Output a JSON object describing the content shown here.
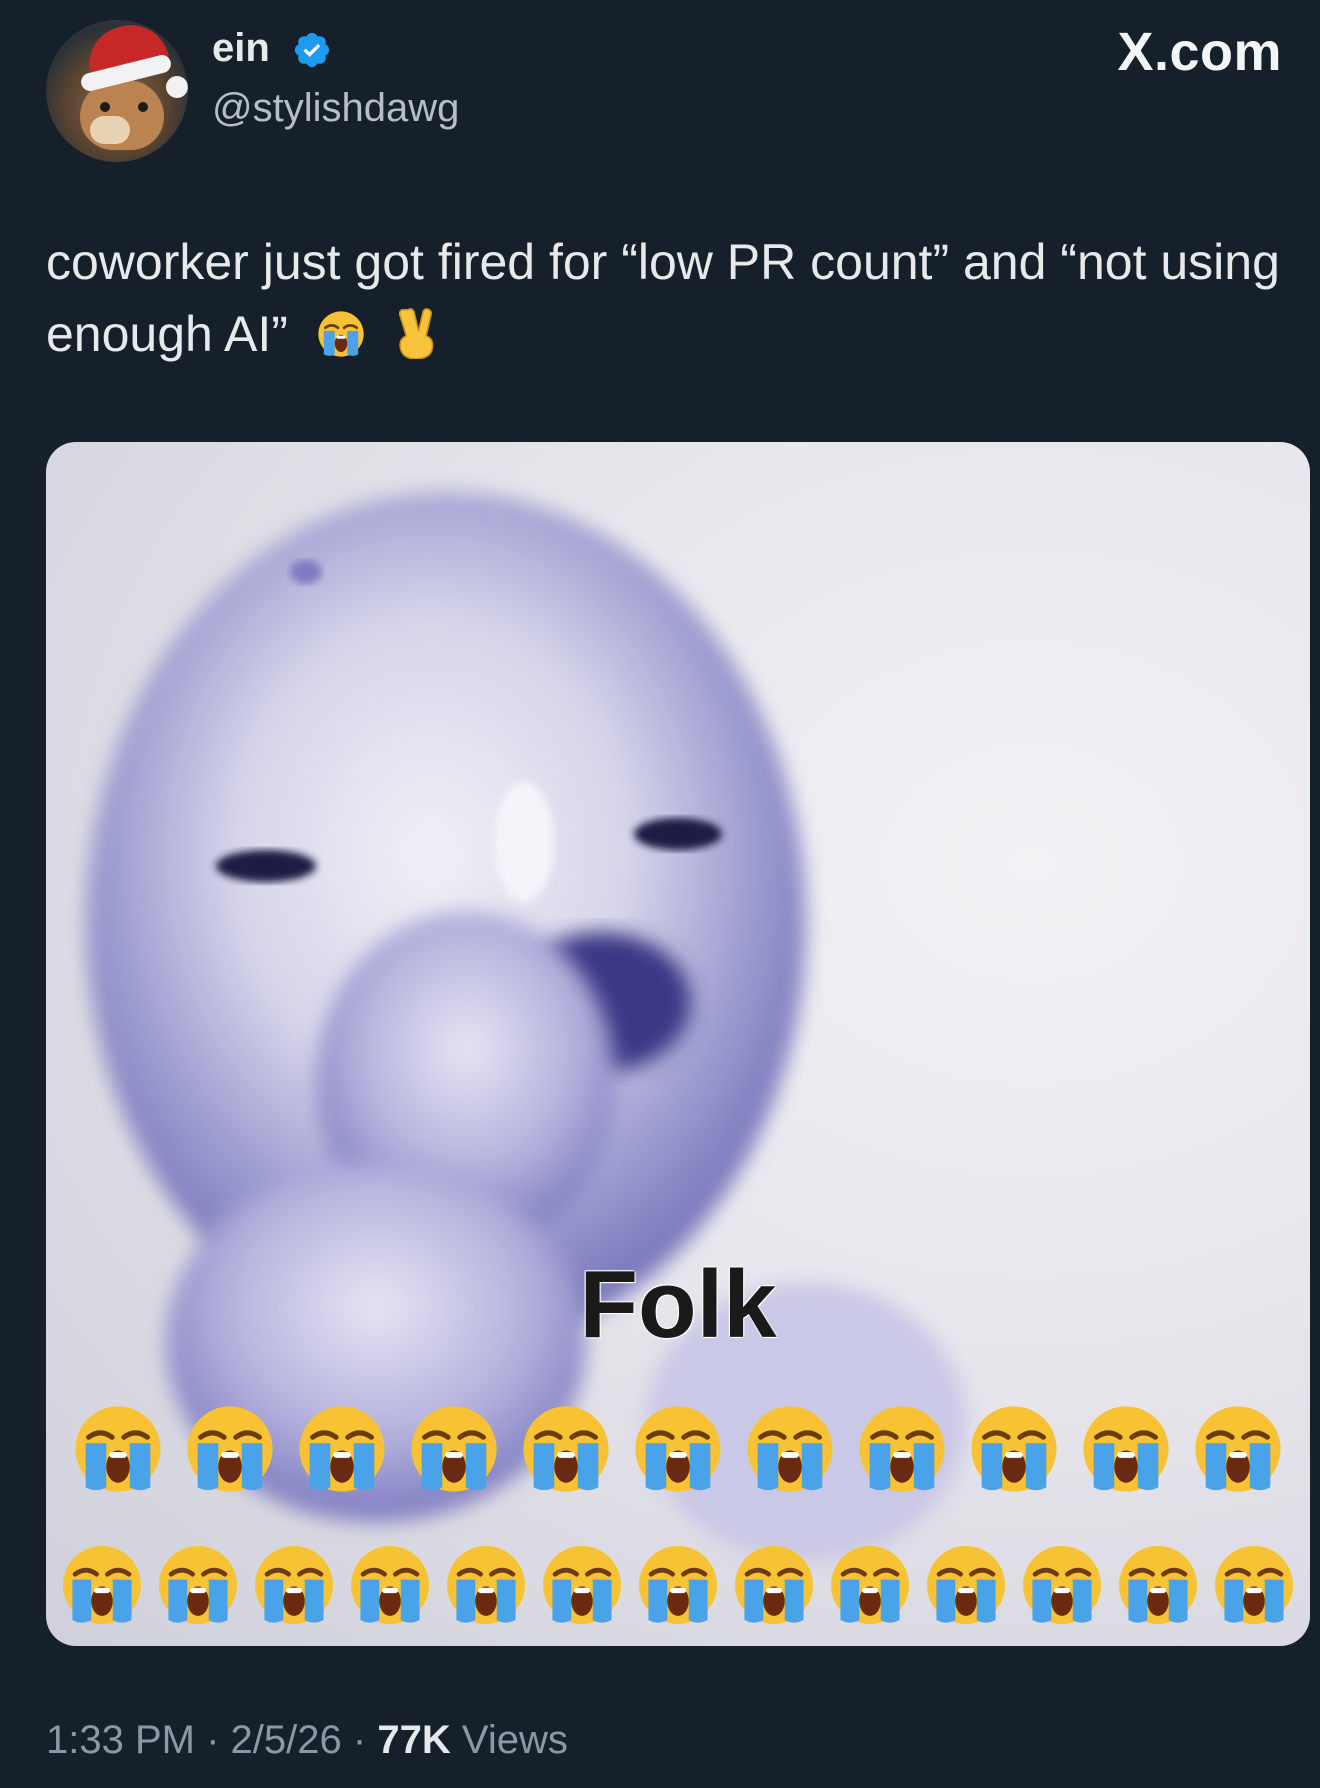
{
  "author": {
    "display_name": "ein",
    "handle": "@stylishdawg",
    "verified": true,
    "avatar_icon": "dog-santa-hat-avatar"
  },
  "brand": "X.com",
  "tweet": {
    "text": "coworker just got fired for “low PR count” and “not using enough AI”",
    "trailing_emoji": [
      "loudly-crying-face-icon",
      "victory-hand-icon"
    ]
  },
  "media": {
    "caption": "Folk",
    "emoji_icon": "loudly-crying-face-icon",
    "emoji_row_1_count": 11,
    "emoji_row_2_count": 13
  },
  "footer": {
    "time": "1:33 PM",
    "date": "2/5/26",
    "views_count": "77K",
    "views_label": "Views",
    "separator": "·"
  },
  "colors": {
    "background": "#15202b",
    "text": "#e7e9ea",
    "muted": "#8b98a5",
    "verified_blue": "#1d9bf0"
  }
}
